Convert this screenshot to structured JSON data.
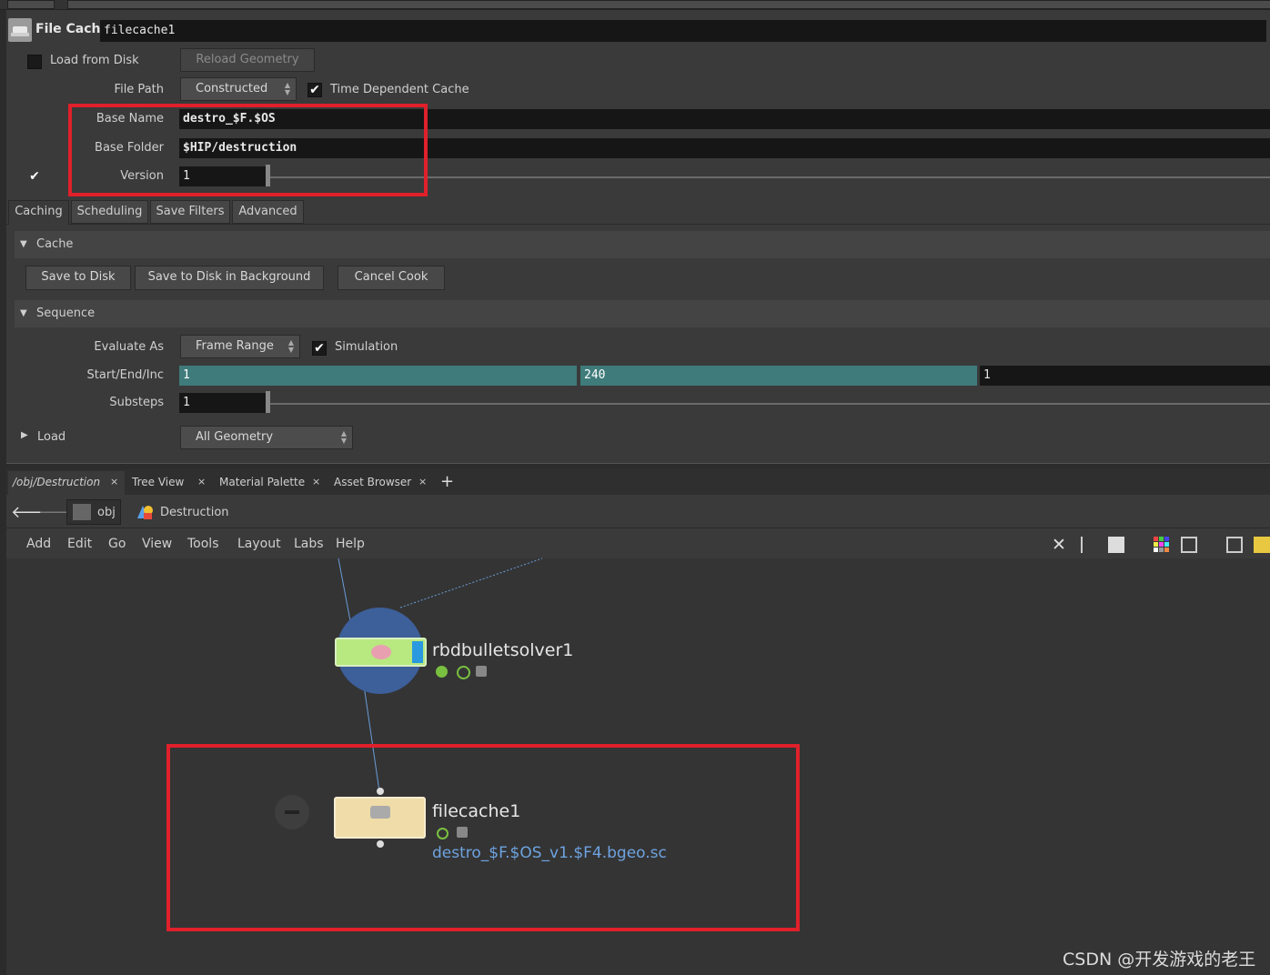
{
  "header": {
    "node_type": "File Cache",
    "node_name": "filecache1"
  },
  "params": {
    "load_from_disk_label": "Load from Disk",
    "reload_geometry": "Reload Geometry",
    "file_path_label": "File Path",
    "file_path_value": "Constructed",
    "time_dependent_label": "Time Dependent Cache",
    "base_name_label": "Base Name",
    "base_name_value": "destro_$F.$OS",
    "base_folder_label": "Base Folder",
    "base_folder_value": "$HIP/destruction",
    "version_label": "Version",
    "version_value": "1"
  },
  "tabs": [
    "Caching",
    "Scheduling",
    "Save Filters",
    "Advanced"
  ],
  "cache_section": {
    "title": "Cache",
    "save_to_disk": "Save to Disk",
    "save_bg": "Save to Disk in Background",
    "cancel_cook": "Cancel Cook"
  },
  "sequence_section": {
    "title": "Sequence",
    "evaluate_as_label": "Evaluate As",
    "evaluate_as_value": "Frame Range",
    "simulation_label": "Simulation",
    "start_end_inc_label": "Start/End/Inc",
    "start": "1",
    "end": "240",
    "inc": "1",
    "substeps_label": "Substeps",
    "substeps_value": "1"
  },
  "load_section": {
    "title": "Load",
    "value": "All Geometry"
  },
  "pane_tabs": [
    "/obj/Destruction",
    "Tree View",
    "Material Palette",
    "Asset Browser"
  ],
  "breadcrumb": {
    "root": "obj",
    "current": "Destruction"
  },
  "menu": [
    "Add",
    "Edit",
    "Go",
    "View",
    "Tools",
    "Layout",
    "Labs",
    "Help"
  ],
  "nodes": {
    "solver_name": "rbdbulletsolver1",
    "cache_name": "filecache1",
    "cache_path": "destro_$F.$OS_v1.$F4.bgeo.sc"
  },
  "watermark": "CSDN @开发游戏的老王",
  "colors": {
    "highlight": "#e0202a",
    "teal": "#3f7b7b",
    "link": "#6ea3e0"
  }
}
